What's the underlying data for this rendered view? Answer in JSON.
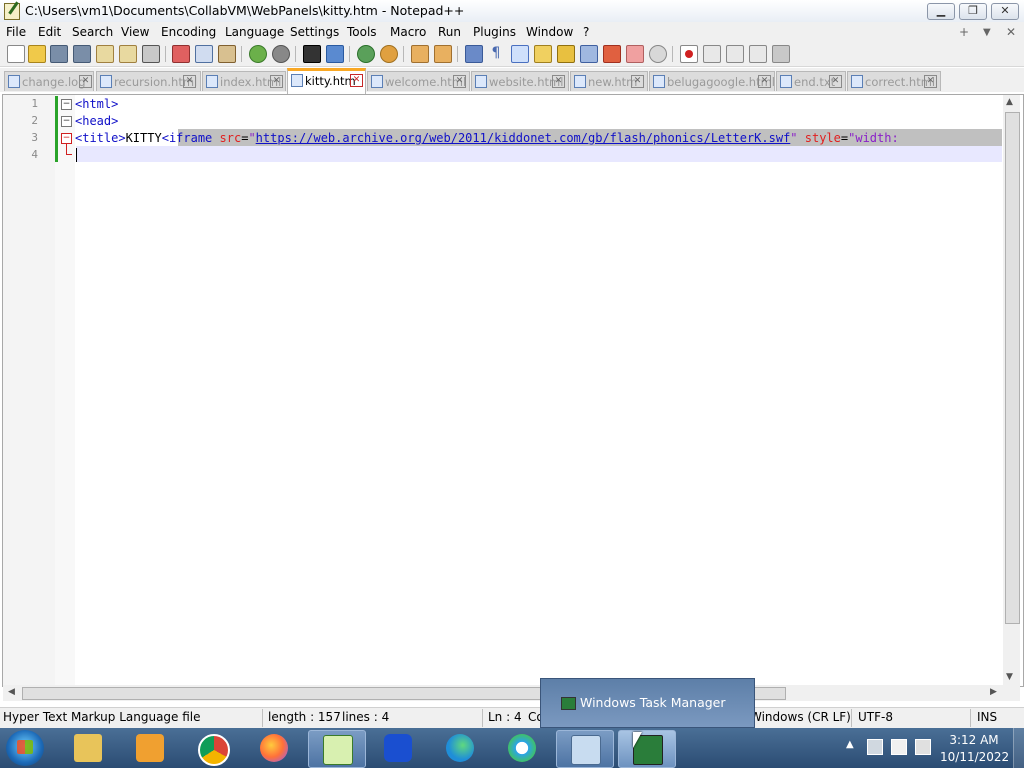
{
  "window": {
    "title": "C:\\Users\\vm1\\Documents\\CollabVM\\WebPanels\\kitty.htm - Notepad++",
    "minimize_label": "▁",
    "restore_label": "❐",
    "close_label": "✕"
  },
  "menu": {
    "items": [
      {
        "label": "File"
      },
      {
        "label": "Edit"
      },
      {
        "label": "Search"
      },
      {
        "label": "View"
      },
      {
        "label": "Encoding"
      },
      {
        "label": "Language"
      },
      {
        "label": "Settings"
      },
      {
        "label": "Tools"
      },
      {
        "label": "Macro"
      },
      {
        "label": "Run"
      },
      {
        "label": "Plugins"
      },
      {
        "label": "Window"
      },
      {
        "label": "?"
      }
    ],
    "right_plus": "+",
    "right_down": "▼",
    "right_close": "✕"
  },
  "tabs": [
    {
      "label": "change.log"
    },
    {
      "label": "recursion.html"
    },
    {
      "label": "index.html"
    },
    {
      "label": "kitty.htm",
      "active": true
    },
    {
      "label": "welcome.html"
    },
    {
      "label": "website.html"
    },
    {
      "label": "new.htm"
    },
    {
      "label": "belugagoogle.html"
    },
    {
      "label": "end.txt"
    },
    {
      "label": "correct.html"
    }
  ],
  "editor": {
    "line_numbers": [
      "1",
      "2",
      "3",
      "4"
    ],
    "lines": {
      "l1": "<html>",
      "l2": "<head>",
      "l3_open": "<title>",
      "l3_text": "KITTY",
      "l3_lt": "<",
      "l3_iframe": "iframe",
      "l3_src_attr": " src",
      "l3_eq": "=",
      "l3_q1": "\"",
      "l3_url": "https://web.archive.org/web/2011/kiddonet.com/gb/flash/phonics/LetterK.swf",
      "l3_q2": "\"",
      "l3_style_attr": " style",
      "l3_eq2": "=",
      "l3_style_val": "\"width:"
    }
  },
  "status": {
    "file_type": "Hyper Text Markup Language file",
    "length": "length : 157",
    "lines": "lines : 4",
    "ln": "Ln : 4",
    "col": "Co",
    "eol": "Windows (CR LF)",
    "encoding": "UTF-8",
    "mode": "INS"
  },
  "popup": {
    "label": "Windows Task Manager"
  },
  "taskbar": {
    "apps": [
      {
        "name": "file-explorer"
      },
      {
        "name": "media-player"
      },
      {
        "name": "chrome"
      },
      {
        "name": "firefox"
      },
      {
        "name": "notepad-plus-plus"
      },
      {
        "name": "malwarebytes"
      },
      {
        "name": "edge"
      },
      {
        "name": "edge-beta"
      },
      {
        "name": "control-panel"
      },
      {
        "name": "task-manager"
      }
    ],
    "clock_time": "3:12 AM",
    "clock_date": "10/11/2022"
  },
  "colors": {
    "tag": "#1010c8",
    "attr": "#e02020",
    "string": "#8a20c8",
    "active_tab_accent": "#f9a825"
  }
}
